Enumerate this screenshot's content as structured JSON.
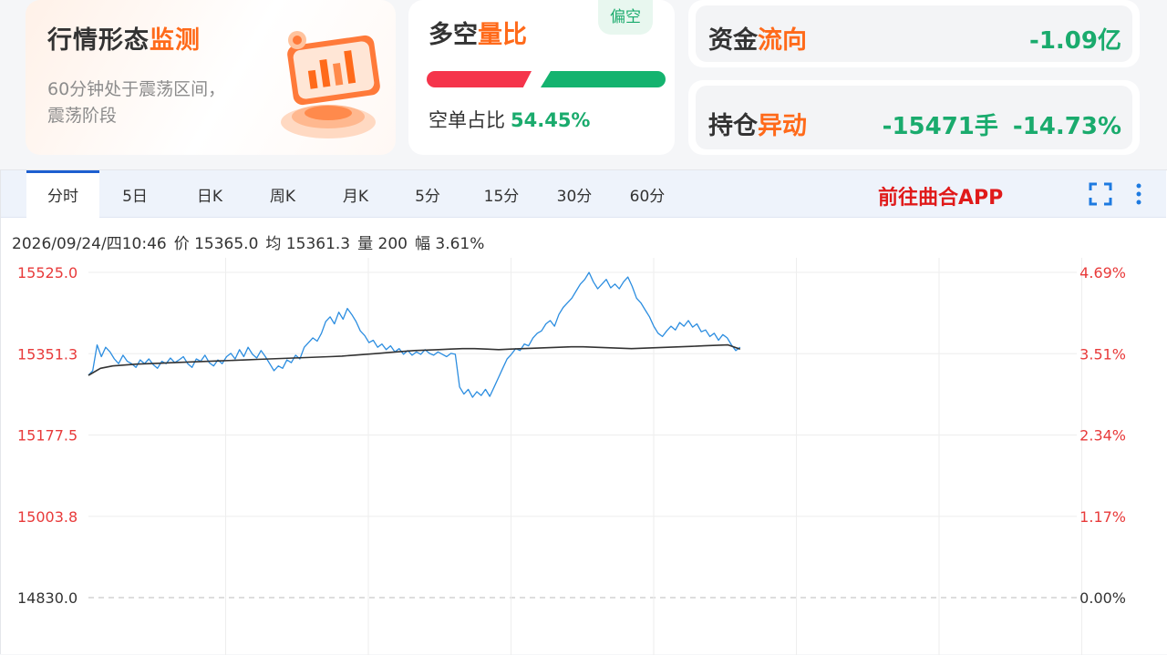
{
  "trend_card": {
    "title_plain": "行情形态",
    "title_highlight": "监测",
    "description": "60分钟处于震荡区间，震荡阶段"
  },
  "long_short_card": {
    "title_plain": "多空",
    "title_highlight": "量比",
    "tag": "偏空",
    "short_ratio_label": "空单占比",
    "short_ratio_value": "54.45%",
    "short_ratio_fraction": 0.5445
  },
  "fund_flow_card": {
    "title_plain": "资金",
    "title_highlight": "流向",
    "value": "-1.09亿"
  },
  "open_interest_card": {
    "title_plain": "持仓",
    "title_highlight": "异动",
    "change_lots": "-15471手",
    "change_pct": "-14.73%"
  },
  "tabs": [
    "分时",
    "5日",
    "日K",
    "周K",
    "月K",
    "5分",
    "15分",
    "30分",
    "60分"
  ],
  "active_tab": "分时",
  "app_link": "前往曲合APP",
  "icons": {
    "fullscreen": "fullscreen-icon",
    "more": "more-vertical-icon"
  },
  "info": {
    "datetime": "2026/09/24/四10:46",
    "price": "价 15365.0",
    "avg": "均 15361.3",
    "volume": "量 200",
    "amplitude": "幅 3.61%"
  },
  "colors": {
    "accent": "#ff6a1a",
    "up": "#f5344b",
    "down": "#14b36f",
    "price_line": "#2b8de0",
    "avg_line": "#333333",
    "tab_active": "#1d5fd0"
  },
  "chart_data": {
    "type": "line",
    "y_labels_left": [
      "15525.0",
      "15351.3",
      "15177.5",
      "15003.8",
      "14830.0"
    ],
    "y_labels_right": [
      "4.69%",
      "3.51%",
      "2.34%",
      "1.17%",
      "0.00%"
    ],
    "ylim": [
      14830.0,
      15525.0
    ],
    "grid": true,
    "vertical_gridlines": 8,
    "total_slots": 230,
    "series": [
      {
        "values": [
          15305,
          15315,
          15370,
          15345,
          15365,
          15355,
          15340,
          15330,
          15348,
          15335,
          15330,
          15322,
          15338,
          15330,
          15340,
          15328,
          15320,
          15335,
          15330,
          15342,
          15332,
          15338,
          15345,
          15330,
          15322,
          15340,
          15335,
          15348,
          15332,
          15325,
          15338,
          15330,
          15345,
          15352,
          15340,
          15360,
          15345,
          15365,
          15350,
          15342,
          15358,
          15345,
          15330,
          15315,
          15325,
          15320,
          15338,
          15332,
          15348,
          15340,
          15365,
          15375,
          15385,
          15378,
          15395,
          15420,
          15430,
          15415,
          15440,
          15425,
          15448,
          15435,
          15420,
          15400,
          15390,
          15375,
          15380,
          15365,
          15372,
          15360,
          15368,
          15355,
          15362,
          15350,
          15358,
          15348,
          15355,
          15350,
          15360,
          15352,
          15348,
          15355,
          15350,
          15345,
          15352,
          15350,
          15280,
          15265,
          15275,
          15258,
          15270,
          15262,
          15275,
          15260,
          15280,
          15300,
          15320,
          15340,
          15350,
          15362,
          15358,
          15372,
          15368,
          15385,
          15395,
          15400,
          15415,
          15422,
          15410,
          15435,
          15450,
          15460,
          15470,
          15485,
          15500,
          15510,
          15525,
          15505,
          15490,
          15500,
          15510,
          15492,
          15500,
          15490,
          15505,
          15515,
          15495,
          15470,
          15460,
          15445,
          15430,
          15410,
          15395,
          15388,
          15400,
          15410,
          15402,
          15418,
          15410,
          15422,
          15408,
          15415,
          15398,
          15402,
          15388,
          15395,
          15380,
          15392,
          15385,
          15370,
          15358,
          15365
        ]
      },
      {
        "values": [
          15305,
          15320,
          15325,
          15327,
          15329,
          15330,
          15331,
          15332,
          15333,
          15334,
          15335,
          15336,
          15337,
          15338,
          15339,
          15340,
          15341,
          15342,
          15343,
          15344,
          15345,
          15346,
          15348,
          15350,
          15352,
          15354,
          15356,
          15358,
          15359,
          15360,
          15361,
          15362,
          15362,
          15361,
          15360,
          15361,
          15362,
          15363,
          15364,
          15365,
          15366,
          15366,
          15365,
          15364,
          15363,
          15362,
          15363,
          15364,
          15365,
          15366,
          15367,
          15368,
          15369,
          15370,
          15361
        ]
      }
    ]
  }
}
